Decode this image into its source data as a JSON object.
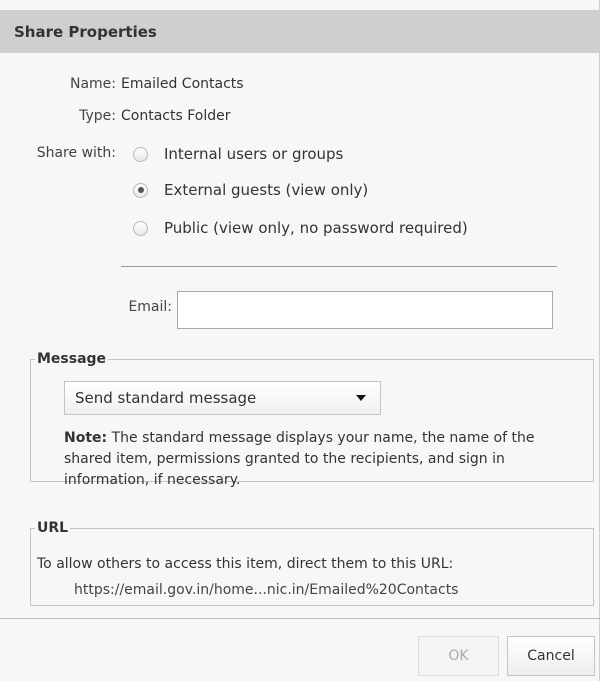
{
  "dialog": {
    "title": "Share Properties"
  },
  "properties": {
    "name_label": "Name:",
    "name_value": "Emailed Contacts",
    "type_label": "Type:",
    "type_value": "Contacts Folder",
    "share_with_label": "Share with:"
  },
  "share_options": [
    {
      "label": "Internal users or groups",
      "selected": false
    },
    {
      "label": "External guests (view only)",
      "selected": true
    },
    {
      "label": "Public (view only, no password required)",
      "selected": false
    }
  ],
  "email": {
    "label": "Email:",
    "value": ""
  },
  "message": {
    "legend": "Message",
    "select_value": "Send standard message",
    "note_bold": "Note:",
    "note_text": " The standard message displays your name, the name of the shared item, permissions granted to the recipients, and sign in information, if necessary."
  },
  "url": {
    "legend": "URL",
    "intro": "To allow others to access this item, direct them to this URL:",
    "link": "https://email.gov.in/home...nic.in/Emailed%20Contacts"
  },
  "buttons": {
    "ok": "OK",
    "cancel": "Cancel",
    "ok_enabled": false
  },
  "colors": {
    "titlebar": "#cfcfcf",
    "background": "#f7f7f7",
    "disabled_text": "#aaaaaa"
  }
}
